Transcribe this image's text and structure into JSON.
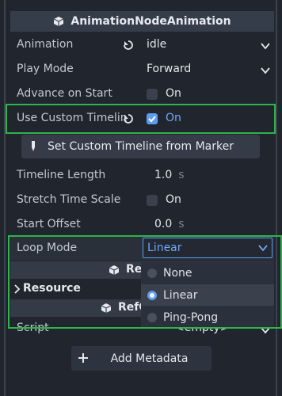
{
  "header": {
    "title": "AnimationNodeAnimation"
  },
  "properties": {
    "animation": {
      "label": "Animation",
      "value": "idle"
    },
    "play_mode": {
      "label": "Play Mode",
      "value": "Forward"
    },
    "advance_on_start": {
      "label": "Advance on Start",
      "checkbox_label": "On",
      "checked": false
    },
    "use_custom_timeline": {
      "label": "Use Custom Timelin",
      "checkbox_label": "On",
      "checked": true
    },
    "set_timeline_button": "Set Custom Timeline from Marker",
    "timeline_length": {
      "label": "Timeline Length",
      "value": "1.0",
      "unit": "s"
    },
    "stretch_time_scale": {
      "label": "Stretch Time Scale",
      "checkbox_label": "On",
      "checked": false
    },
    "start_offset": {
      "label": "Start Offset",
      "value": "0.0",
      "unit": "s"
    },
    "loop_mode": {
      "label": "Loop Mode",
      "value": "Linear"
    }
  },
  "loop_dropdown": {
    "options": [
      "None",
      "Linear",
      "Ping-Pong"
    ],
    "selected": "Linear"
  },
  "sections": {
    "res_partial": "Res",
    "resource": "Resource",
    "refc_partial": "RefC"
  },
  "script": {
    "label": "Script",
    "value": "<empty>"
  },
  "add_metadata": "Add Metadata",
  "colors": {
    "background": "#20252e",
    "accent": "#5f9cf0",
    "highlight_green": "#2fb34d"
  }
}
